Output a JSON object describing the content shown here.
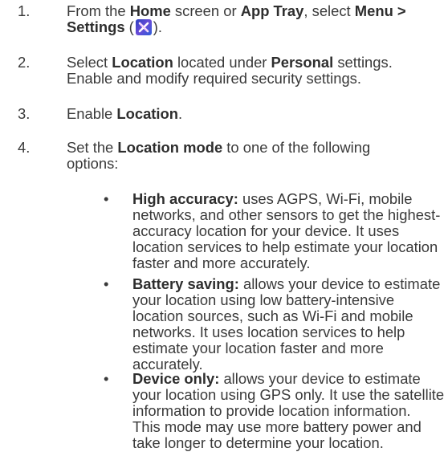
{
  "steps": [
    {
      "number": "1.",
      "line1_a": "From the ",
      "line1_b": "Home",
      "line1_c": " screen or ",
      "line1_d": "App Tray",
      "line1_e": ", select ",
      "line1_f": "Menu >",
      "line2_a": "Settings",
      "line2_b": " (",
      "line2_c": ").",
      "icon": "settings-app-icon"
    },
    {
      "number": "2.",
      "line1_a": "Select ",
      "line1_b": "Location",
      "line1_c": " located under ",
      "line1_d": "Personal",
      "line1_e": " settings.",
      "line2": "Enable and modify required security settings."
    },
    {
      "number": "3.",
      "line1_a": "Enable ",
      "line1_b": "Location",
      "line1_c": "."
    },
    {
      "number": "4.",
      "line1_a": "Set the ",
      "line1_b": "Location mode",
      "line1_c": " to one of the following",
      "line2": "options:"
    }
  ],
  "options": [
    {
      "bullet": "•",
      "title": "High accuracy:",
      "lines": [
        " uses AGPS, Wi-Fi, mobile",
        "networks, and other sensors to get the highest-",
        "accuracy location for your device. It uses",
        "location services to help estimate your location",
        "faster and more accurately."
      ]
    },
    {
      "bullet": "•",
      "title": "Battery saving:",
      "lines": [
        " allows your device to estimate",
        "your location using low battery-intensive",
        "location sources, such as Wi-Fi and mobile",
        "networks. It uses location services to help",
        "estimate your location faster and more",
        "accurately."
      ]
    },
    {
      "bullet": "•",
      "title": "Device only:",
      "lines": [
        " allows your device to estimate",
        "your location using GPS only. It use the satellite",
        "information to provide location information.",
        "This mode may use more battery power and",
        "take longer to determine your location."
      ]
    }
  ]
}
